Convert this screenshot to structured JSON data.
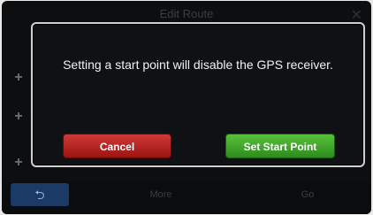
{
  "background": {
    "title": "Edit Route",
    "close_icon": "close-icon",
    "side_buttons": [
      "+",
      "+",
      "+"
    ],
    "bottom_bar": {
      "back_icon": "back-arrow-icon",
      "more_label": "More",
      "go_label": "Go"
    }
  },
  "dialog": {
    "message": "Setting a start point will disable the GPS receiver.",
    "cancel_label": "Cancel",
    "confirm_label": "Set Start Point"
  },
  "colors": {
    "cancel": "#b52422",
    "confirm": "#3fa82a",
    "back_button": "#1b3a66"
  }
}
